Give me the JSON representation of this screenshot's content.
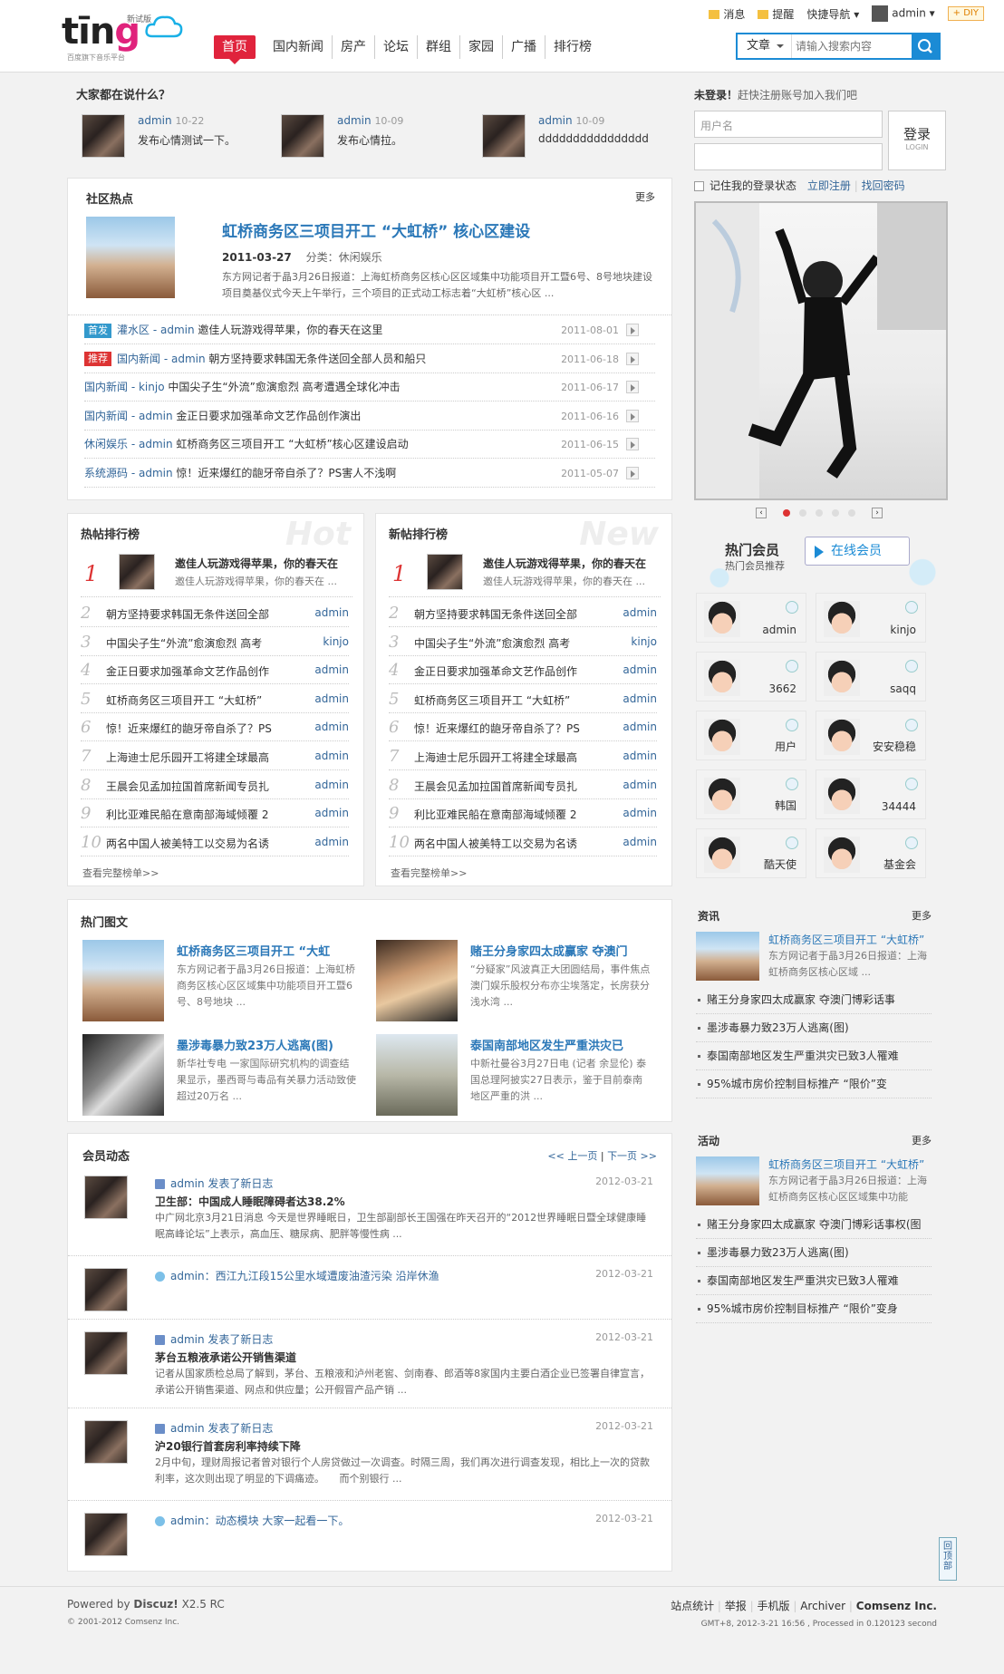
{
  "header": {
    "logo_text": "ting",
    "logo_beta": "新试版",
    "logo_sub": "百度旗下音乐平台",
    "nav": [
      "首页",
      "国内新闻",
      "房产",
      "论坛",
      "群组",
      "家园",
      "广播",
      "排行榜"
    ],
    "topbar": {
      "msg": "消息",
      "remind": "提醒",
      "quicknav": "快捷导航",
      "user": "admin",
      "diy": "DIY"
    },
    "search": {
      "category": "文章",
      "placeholder": "请输入搜索内容"
    }
  },
  "talking": {
    "title": "大家都在说什么？",
    "items": [
      {
        "user": "admin",
        "date": "10-22",
        "text": "发布心情测试一下。"
      },
      {
        "user": "admin",
        "date": "10-09",
        "text": "发布心情拉。"
      },
      {
        "user": "admin",
        "date": "10-09",
        "text": "dddddddddddddddd"
      }
    ]
  },
  "hot": {
    "title": "社区热点",
    "more": "更多",
    "lead": {
      "title": "虹桥商务区三项目开工 “大虹桥” 核心区建设",
      "date": "2011-03-27",
      "cat_label": "分类：",
      "cat": "休闲娱乐",
      "summary": "东方网记者于晶3月26日报道：上海虹桥商务区核心区区域集中功能项目开工暨6号、8号地块建设项目奠基仪式今天上午举行，三个项目的正式动工标志着“大虹桥”核心区 ..."
    },
    "rows": [
      {
        "tag": "首发",
        "tagcolor": "#3399cc",
        "cat": "灌水区",
        "user": "admin",
        "text": "邀佳人玩游戏得苹果，你的春天在这里",
        "date": "2011-08-01"
      },
      {
        "tag": "推荐",
        "tagcolor": "#dd3333",
        "cat": "国内新闻",
        "user": "admin",
        "text": "朝方坚持要求韩国无条件送回全部人员和船只",
        "date": "2011-06-18"
      },
      {
        "tag": "",
        "cat": "国内新闻",
        "user": "kinjo",
        "text": "中国尖子生“外流”愈演愈烈 高考遭遇全球化冲击",
        "date": "2011-06-17"
      },
      {
        "tag": "",
        "cat": "国内新闻",
        "user": "admin",
        "text": "金正日要求加强革命文艺作品创作演出",
        "date": "2011-06-16"
      },
      {
        "tag": "",
        "cat": "休闲娱乐",
        "user": "admin",
        "text": "虹桥商务区三项目开工 “大虹桥”核心区建设启动",
        "date": "2011-06-15"
      },
      {
        "tag": "",
        "cat": "系统源码",
        "user": "admin",
        "text": "惊！近来爆红的龅牙帝自杀了？PS害人不浅啊",
        "date": "2011-05-07"
      }
    ]
  },
  "hotrank": {
    "title": "热帖排行榜",
    "watermark": "Hot",
    "more": "查看完整榜单>>",
    "first": {
      "title": "邀佳人玩游戏得苹果，你的春天在",
      "sub": "邀佳人玩游戏得苹果，你的春天在 ..."
    },
    "rows": [
      {
        "n": "2",
        "t": "朝方坚持要求韩国无条件送回全部",
        "u": "admin"
      },
      {
        "n": "3",
        "t": "中国尖子生“外流”愈演愈烈 高考",
        "u": "kinjo"
      },
      {
        "n": "4",
        "t": "金正日要求加强革命文艺作品创作",
        "u": "admin"
      },
      {
        "n": "5",
        "t": "虹桥商务区三项目开工 “大虹桥”",
        "u": "admin"
      },
      {
        "n": "6",
        "t": "惊！近来爆红的龅牙帝自杀了？PS",
        "u": "admin"
      },
      {
        "n": "7",
        "t": "上海迪士尼乐园开工将建全球最高",
        "u": "admin"
      },
      {
        "n": "8",
        "t": "王晨会见孟加拉国首席新闻专员扎",
        "u": "admin"
      },
      {
        "n": "9",
        "t": "利比亚难民船在意南部海域倾覆 2",
        "u": "admin"
      },
      {
        "n": "10",
        "t": "两名中国人被美特工以交易为名诱",
        "u": "admin"
      }
    ]
  },
  "newrank": {
    "title": "新帖排行榜",
    "watermark": "New",
    "more": "查看完整榜单>>",
    "first": {
      "title": "邀佳人玩游戏得苹果，你的春天在",
      "sub": "邀佳人玩游戏得苹果，你的春天在 ..."
    },
    "rows": [
      {
        "n": "2",
        "t": "朝方坚持要求韩国无条件送回全部",
        "u": "admin"
      },
      {
        "n": "3",
        "t": "中国尖子生“外流”愈演愈烈 高考",
        "u": "kinjo"
      },
      {
        "n": "4",
        "t": "金正日要求加强革命文艺作品创作",
        "u": "admin"
      },
      {
        "n": "5",
        "t": "虹桥商务区三项目开工 “大虹桥”",
        "u": "admin"
      },
      {
        "n": "6",
        "t": "惊！近来爆红的龅牙帝自杀了？PS",
        "u": "admin"
      },
      {
        "n": "7",
        "t": "上海迪士尼乐园开工将建全球最高",
        "u": "admin"
      },
      {
        "n": "8",
        "t": "王晨会见孟加拉国首席新闻专员扎",
        "u": "admin"
      },
      {
        "n": "9",
        "t": "利比亚难民船在意南部海域倾覆 2",
        "u": "admin"
      },
      {
        "n": "10",
        "t": "两名中国人被美特工以交易为名诱",
        "u": "admin"
      }
    ]
  },
  "pics": {
    "title": "热门图文",
    "items": [
      {
        "t": "虹桥商务区三项目开工 “大虹",
        "s": "东方网记者于晶3月26日报道：上海虹桥商务区核心区区域集中功能项目开工暨6号、8号地块 ..."
      },
      {
        "t": "赌王分身家四太成赢家 夺澳门",
        "s": "“分疑家”风波真正大团圆结局，事件焦点澳门娱乐股权分布亦尘埃落定，长房获分浅水湾 ..."
      },
      {
        "t": "墨涉毒暴力致23万人逃离(图)",
        "s": "新华社专电 一家国际研究机构的调查结果显示，墨西哥与毒品有关暴力活动致使超过20万名 ..."
      },
      {
        "t": "泰国南部地区发生严重洪灾已",
        "s": "中新社曼谷3月27日电 (记者 余显伦) 泰国总理阿披实27日表示，鉴于目前泰南地区严重的洪 ..."
      }
    ]
  },
  "feed": {
    "title": "会员动态",
    "prev": "<< 上一页",
    "sep": "|",
    "next": "下一页 >>",
    "items": [
      {
        "who": "admin 发表了新日志",
        "date": "2012-03-21",
        "title": "卫生部：中国成人睡眠障碍者达38.2%",
        "body": "中广网北京3月21日消息 今天是世界睡眠日，卫生部副部长王国强在昨天召开的“2012世界睡眠日暨全球健康睡眠高峰论坛”上表示，高血压、糖尿病、肥胖等慢性病 ..."
      },
      {
        "who": "admin：西江九江段15公里水域遭废油渣污染 沿岸休渔",
        "date": "2012-03-21",
        "title": "",
        "body": ""
      },
      {
        "who": "admin 发表了新日志",
        "date": "2012-03-21",
        "title": "茅台五粮液承诺公开销售渠道",
        "body": "记者从国家质检总局了解到，茅台、五粮液和泸州老窖、剑南春、郎酒等8家国内主要白酒企业已签署自律宣言，承诺公开销售渠道、网点和供应量；公开假冒产品产销 ..."
      },
      {
        "who": "admin 发表了新日志",
        "date": "2012-03-21",
        "title": "沪20银行首套房利率持续下降",
        "body": "2月中旬，理财周报记者曾对银行个人房贷做过一次调查。时隔三周，我们再次进行调查发现，相比上一次的贷款利率，这次则出现了明显的下调痛迹。　　而个别银行 ..."
      },
      {
        "who": "admin：动态模块 大家一起看一下。",
        "date": "2012-03-21",
        "title": "",
        "body": ""
      }
    ]
  },
  "login": {
    "title": "未登录！",
    "sub": "赶快注册账号加入我们吧",
    "user_ph": "用户名",
    "btn": "登录",
    "btn_sub": "LOGIN",
    "remember": "记住我的登录状态",
    "register": "立即注册",
    "forgot": "找回密码"
  },
  "members": {
    "title": "热门会员",
    "sub": "热门会员推荐",
    "online": "在线会员",
    "list": [
      "admin",
      "kinjo",
      "3662",
      "saqq",
      "用户",
      "安安稳稳",
      "韩国",
      "34444",
      "酷天使",
      "基金会"
    ]
  },
  "news": {
    "title": "资讯",
    "more": "更多",
    "lead": {
      "t": "虹桥商务区三项目开工 “大虹桥”",
      "s": "东方网记者于晶3月26日报道：上海虹桥商务区核心区域 ..."
    },
    "items": [
      "赌王分身家四太成赢家 夺澳门博彩话事",
      "墨涉毒暴力致23万人逃离(图)",
      "泰国南部地区发生严重洪灾已致3人罹难",
      "95%城市房价控制目标推产 “限价”变"
    ]
  },
  "activity": {
    "title": "活动",
    "more": "更多",
    "lead": {
      "t": "虹桥商务区三项目开工 “大虹桥”",
      "s": "东方网记者于晶3月26日报道：上海虹桥商务区核心区区域集中功能"
    },
    "items": [
      "赌王分身家四太成赢家 夺澳门博彩话事权(图",
      "墨涉毒暴力致23万人逃离(图)",
      "泰国南部地区发生严重洪灾已致3人罹难",
      "95%城市房价控制目标推产 “限价”变身"
    ]
  },
  "footer": {
    "powered": "Powered by",
    "brand": "Discuz!",
    "ver": "X2.5 RC",
    "copy": "© 2001-2012 Comsenz Inc.",
    "links": [
      "站点统计",
      "举报",
      "手机版",
      "Archiver"
    ],
    "company": "Comsenz Inc.",
    "gmt": "GMT+8, 2012-3-21 16:56 , Processed in 0.120123 second",
    "totop": "回顶部"
  }
}
